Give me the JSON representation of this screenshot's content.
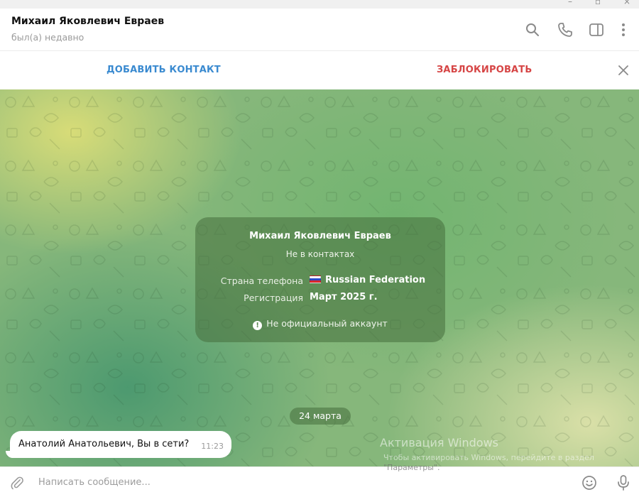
{
  "window": {
    "minimize_glyph": "–",
    "maximize_glyph": "▫",
    "close_glyph": "×"
  },
  "header": {
    "contact_name": "Михаил Яковлевич Евраев",
    "status": "был(а) недавно",
    "icons": [
      "search-icon",
      "phone-icon",
      "sidebar-toggle-icon",
      "more-vertical-icon"
    ]
  },
  "action_bar": {
    "add_contact_label": "ДОБАВИТЬ КОНТАКТ",
    "block_label": "ЗАБЛОКИРОВАТЬ",
    "add_contact_color": "#3a8ad0",
    "block_color": "#d64545"
  },
  "info_card": {
    "name": "Михаил Яковлевич Евраев",
    "subtitle": "Не в контактах",
    "phone_country_label": "Страна телефона",
    "phone_country_value": "Russian Federation",
    "registration_label": "Регистрация",
    "registration_value": "Март 2025 г.",
    "warning_glyph": "!",
    "warning": "Не официальный аккаунт"
  },
  "date_separator": "24 марта",
  "messages": [
    {
      "text": "Анатолий Анатольевич, Вы в сети?",
      "time": "11:23",
      "direction": "incoming"
    }
  ],
  "overlay": {
    "activation_title": "Активация Windows",
    "activation_line": "Чтобы активировать Windows, перейдите в раздел",
    "activation_settings": "\"Параметры\"."
  },
  "composer": {
    "placeholder": "Написать сообщение...",
    "value": ""
  }
}
